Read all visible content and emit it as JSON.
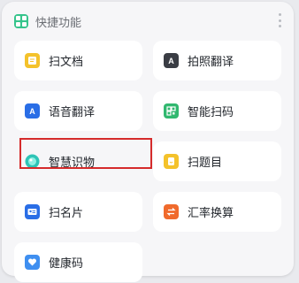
{
  "header": {
    "title": "快捷功能",
    "icon": "apps-grid-icon",
    "accent": "#36c48c"
  },
  "menu": {
    "icon": "more-vertical-icon"
  },
  "items": [
    {
      "label": "扫文档",
      "icon": "document-scan-icon",
      "color": "#f4c22b"
    },
    {
      "label": "拍照翻译",
      "icon": "camera-translate-icon",
      "color": "#3a3d44"
    },
    {
      "label": "语音翻译",
      "icon": "voice-translate-icon",
      "color": "#2a6ee6"
    },
    {
      "label": "智能扫码",
      "icon": "qr-scan-icon",
      "color": "#31b86f"
    },
    {
      "label": "智慧识物",
      "icon": "object-recognition-icon",
      "color": "#2ec4b6"
    },
    {
      "label": "扫题目",
      "icon": "question-scan-icon",
      "color": "#f4c22b"
    },
    {
      "label": "扫名片",
      "icon": "business-card-icon",
      "color": "#2a6ee6"
    },
    {
      "label": "汇率换算",
      "icon": "currency-exchange-icon",
      "color": "#f06a2c"
    },
    {
      "label": "健康码",
      "icon": "health-code-icon",
      "color": "#3f8ff0"
    }
  ]
}
